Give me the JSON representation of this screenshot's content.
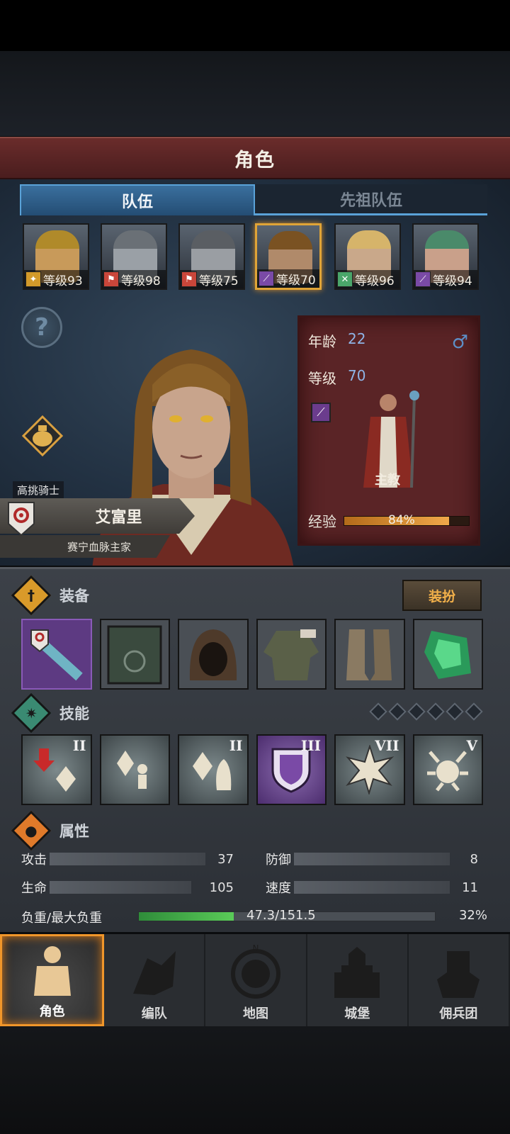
{
  "header": {
    "title": "角色"
  },
  "tabs": [
    {
      "label": "队伍",
      "active": true
    },
    {
      "label": "先祖队伍",
      "active": false
    }
  ],
  "roster": [
    {
      "level": "等级93",
      "badge_color": "#d39a2a",
      "skin": "#c89a5a",
      "hair": "#b08a2a"
    },
    {
      "level": "等级98",
      "badge_color": "#c9463a",
      "skin": "#9aa0a6",
      "hair": "#6a7076"
    },
    {
      "level": "等级75",
      "badge_color": "#c9463a",
      "skin": "#9a9ea3",
      "hair": "#5a5e63"
    },
    {
      "level": "等级70",
      "badge_color": "#7a4aa6",
      "skin": "#b08a6a",
      "hair": "#7a5222",
      "selected": true
    },
    {
      "level": "等级96",
      "badge_color": "#4aa66a",
      "skin": "#c9a88a",
      "hair": "#d6b46a"
    },
    {
      "level": "等级94",
      "badge_color": "#7a4aa6",
      "skin": "#c9a08a",
      "hair": "#4a8a6a"
    }
  ],
  "character": {
    "rank": "高挑骑士",
    "name": "艾富里",
    "house": "赛宁血脉主家",
    "age_label": "年龄",
    "age": "22",
    "level_label": "等级",
    "level": "70",
    "class_name": "主教",
    "exp_label": "经验",
    "exp_percent_text": "84%",
    "exp_fraction": 0.84
  },
  "equipment": {
    "title": "装备",
    "dress_button": "装扮",
    "slots": [
      "weapon",
      "book",
      "hood",
      "tunic",
      "boots",
      "charm"
    ]
  },
  "skills": {
    "title": "技能",
    "tiers": [
      "II",
      "",
      "II",
      "III",
      "VII",
      "V"
    ],
    "pips": 6
  },
  "attributes": {
    "title": "属性",
    "attack_label": "攻击",
    "attack": "37",
    "defense_label": "防御",
    "defense": "8",
    "hp_label": "生命",
    "hp": "105",
    "speed_label": "速度",
    "speed": "11",
    "load_label": "负重/最大负重",
    "load_text": "47.3/151.5",
    "load_pct": "32%",
    "load_fraction": 0.32
  },
  "nav": [
    {
      "label": "角色",
      "active": true
    },
    {
      "label": "编队",
      "active": false
    },
    {
      "label": "地图",
      "active": false
    },
    {
      "label": "城堡",
      "active": false
    },
    {
      "label": "佣兵团",
      "active": false
    }
  ],
  "colors": {
    "accent": "#f0962a",
    "tab_blue": "#5aa2d8",
    "header_red": "#5a2426"
  }
}
